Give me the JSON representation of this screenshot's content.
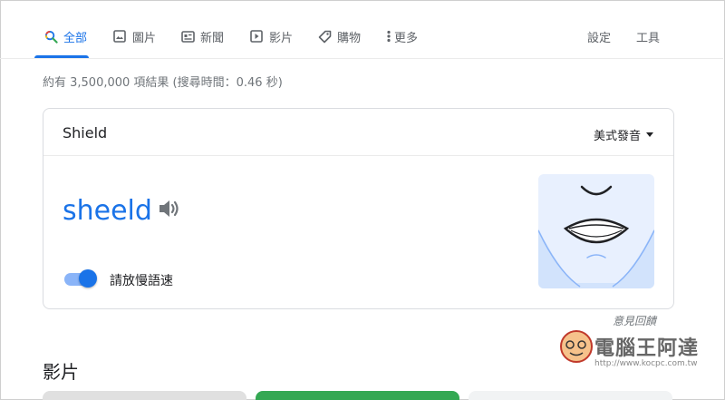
{
  "tabs": [
    {
      "label": "全部",
      "icon": "search-icon"
    },
    {
      "label": "圖片",
      "icon": "image-icon"
    },
    {
      "label": "新聞",
      "icon": "news-icon"
    },
    {
      "label": "影片",
      "icon": "video-icon"
    },
    {
      "label": "購物",
      "icon": "tag-icon"
    },
    {
      "label": "更多",
      "icon": "more-vert-icon"
    }
  ],
  "settings_label": "設定",
  "tools_label": "工具",
  "result_stats": "約有 3,500,000 項結果 (搜尋時間：0.46 秒)",
  "card": {
    "term": "Shield",
    "accent": "美式發音",
    "pronunciation": "sheeld",
    "slow_toggle": {
      "label": "請放慢語速",
      "on": true
    }
  },
  "feedback": "意見回饋",
  "section_title": "影片",
  "watermark": {
    "title": "電腦王阿達",
    "url": "http://www.kocpc.com.tw"
  },
  "colors": {
    "accent": "#1a73e8",
    "muted": "#70757a",
    "border": "#dadce0",
    "mouth_bg": "#e8f0fe"
  }
}
